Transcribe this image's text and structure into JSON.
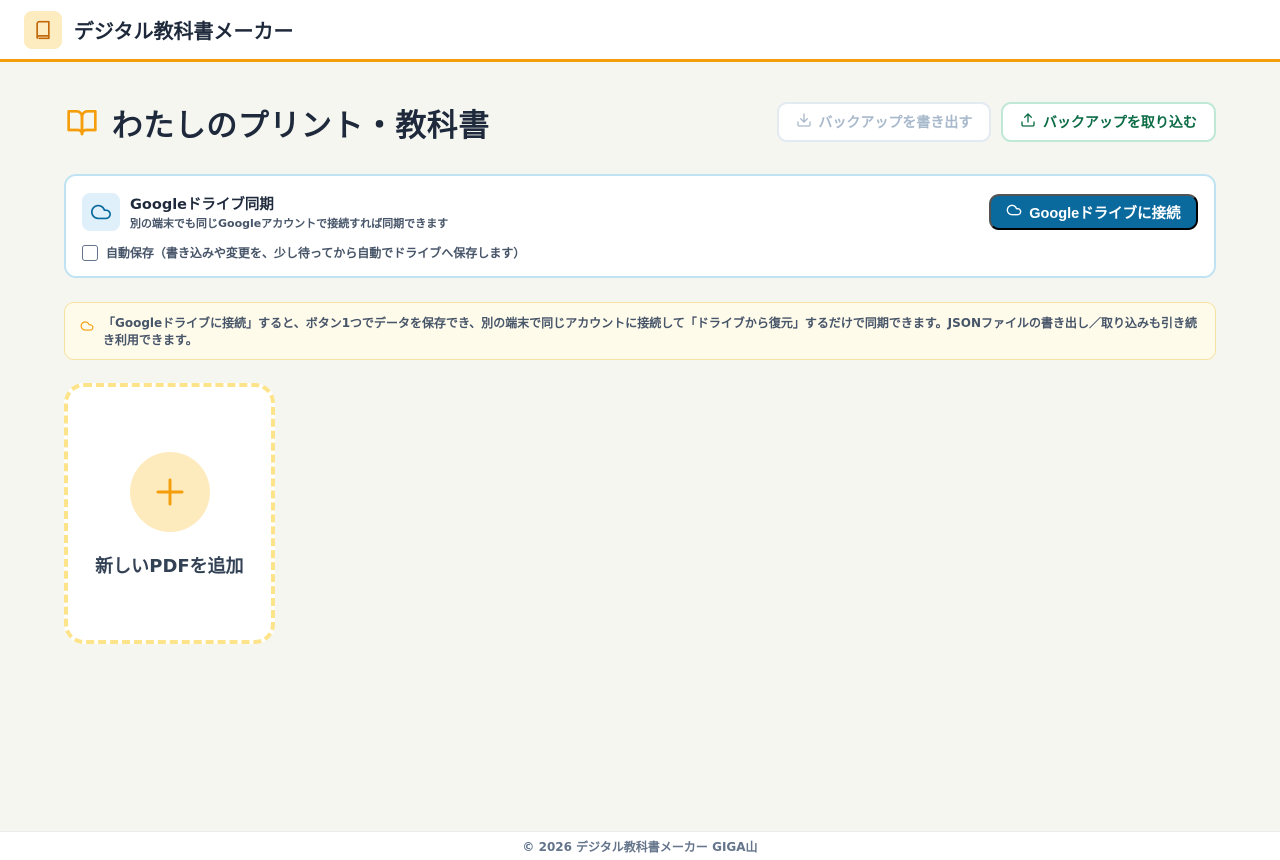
{
  "app": {
    "title": "デジタル教科書メーカー",
    "logo_icon": "book-icon",
    "accent_color": "#f59e0b"
  },
  "page": {
    "title": "わたしのプリント・教科書",
    "title_icon": "open-book-icon"
  },
  "actions": {
    "export_label": "バックアップを書き出す",
    "export_icon": "download-icon",
    "export_disabled": true,
    "import_label": "バックアップを取り込む",
    "import_icon": "upload-icon"
  },
  "sync": {
    "title": "Googleドライブ同期",
    "description": "別の端末でも同じGoogleアカウントで接続すれば同期できます",
    "icon": "cloud-icon",
    "connect_label": "Googleドライブに接続",
    "connect_color": "#0a6a9e",
    "autosave_label": "自動保存（書き込みや変更を、少し待ってから自動でドライブへ保存します）",
    "autosave_checked": false
  },
  "notice": {
    "icon": "cloud-icon",
    "text": "「Googleドライブに接続」すると、ボタン1つでデータを保存でき、別の端末で同じアカウントに接続して「ドライブから復元」するだけで同期できます。JSONファイルの書き出し／取り込みも引き続き利用できます。"
  },
  "add_card": {
    "label": "新しいPDFを追加",
    "icon": "plus-icon"
  },
  "footer": {
    "text": "© 2026 デジタル教科書メーカー GIGA山"
  }
}
